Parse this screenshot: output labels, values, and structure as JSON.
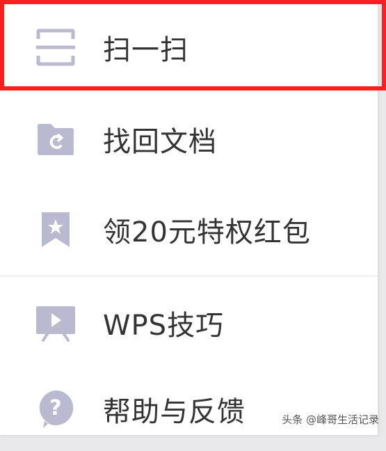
{
  "menu": {
    "items": [
      {
        "label": "扫一扫",
        "icon": "scan-icon"
      },
      {
        "label": "找回文档",
        "icon": "recover-folder-icon"
      },
      {
        "label": "领20元特权红包",
        "icon": "bookmark-star-icon"
      },
      {
        "label": "WPS技巧",
        "icon": "video-tips-icon"
      },
      {
        "label": "帮助与反馈",
        "icon": "help-question-icon"
      }
    ]
  },
  "watermark": {
    "text": "头条 @峰哥生活记录"
  },
  "colors": {
    "icon": "#b9bad0",
    "highlight": "#ff1f1f",
    "text": "#333333"
  }
}
